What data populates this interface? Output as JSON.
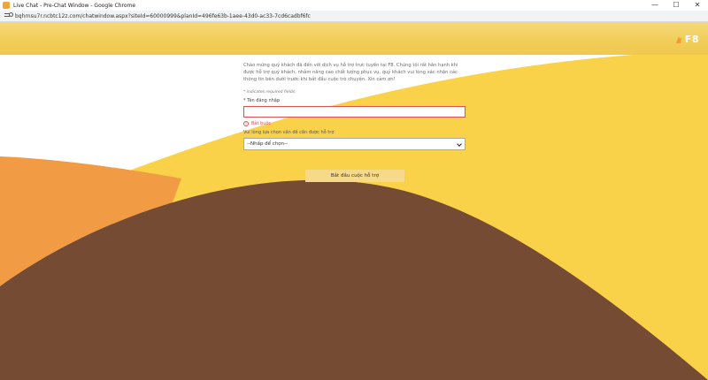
{
  "window": {
    "title": "Live Chat - Pre-Chat Window - Google Chrome",
    "controls": [
      "—",
      "☐",
      "✕"
    ]
  },
  "address": {
    "url": "bqhrnsu7r.ncbtc12z.com/chatwindow.aspx?siteId=60000999&planId=496fe63b-1aee-43d0-ac33-7cd6cadbf6fc"
  },
  "logo": {
    "text": "F8",
    "colors": {
      "mark": "#f29a2e",
      "text": "#ffffff"
    }
  },
  "form": {
    "intro": "Chào mừng quý khách đã đến với dịch vụ hỗ trợ trực tuyến tại F8. Chúng tôi rất hân hạnh khi được hỗ trợ quý khách, nhằm nâng cao chất lượng phục vụ, quý khách vui lòng xác nhận các thông tin bên dưới trước khi bắt đầu cuộc trò chuyện. Xin cảm ơn!",
    "required_note": "* indicates required fields.",
    "username_label": "* Tên đăng nhập",
    "username_value": "",
    "error_text": "Bắt buộc",
    "topic_label": "Vui lòng lựa chọn vấn đề cần được hỗ trợ",
    "topic_selected": "--Nhấp để chọn--",
    "start_button": "Bắt đầu cuộc hỗ trợ"
  },
  "colors": {
    "header": "#f1cd57",
    "bg_yellow": "#fad24a",
    "bg_orange": "#f19b45",
    "bg_brown": "#754b33",
    "error": "#d9534f",
    "button": "#f7d98a"
  }
}
